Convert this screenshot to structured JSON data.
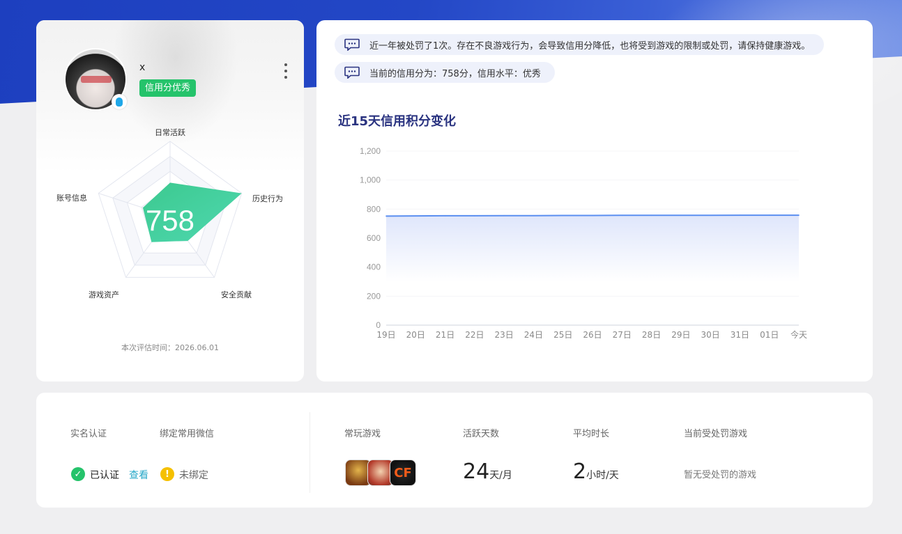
{
  "profile": {
    "username": "x",
    "credit_tag": "信用分优秀",
    "score": "758",
    "eval_time": "本次评估时间：2026.06.01",
    "radar": {
      "axes": [
        "日常活跃",
        "历史行为",
        "安全贡献",
        "游戏资产",
        "账号信息"
      ],
      "values": [
        0.45,
        1.0,
        0.4,
        0.42,
        0.38
      ]
    }
  },
  "notices": [
    "近一年被处罚了1次。存在不良游戏行为，会导致信用分降低，也将受到游戏的限制或处罚，请保持健康游戏。",
    "当前的信用分为：758分，信用水平：优秀"
  ],
  "chart_data": {
    "type": "area",
    "title": "近15天信用积分变化",
    "categories": [
      "19日",
      "20日",
      "21日",
      "22日",
      "23日",
      "24日",
      "25日",
      "26日",
      "27日",
      "28日",
      "29日",
      "30日",
      "31日",
      "01日",
      "今天"
    ],
    "values": [
      752,
      753,
      754,
      754,
      755,
      755,
      756,
      756,
      757,
      757,
      757,
      757,
      758,
      758,
      758
    ],
    "ylim": [
      0,
      1200
    ],
    "yticks": [
      0,
      200,
      400,
      600,
      800,
      1000,
      1200
    ],
    "ytick_labels": [
      "0",
      "200",
      "400",
      "600",
      "800",
      "1,000",
      "1,200"
    ],
    "color": "#5b8ff0"
  },
  "info": {
    "realname_label": "实名认证",
    "wechat_label": "绑定常用微信",
    "realname_value": "已认证",
    "view_link": "查看",
    "wechat_value": "未绑定",
    "games_label": "常玩游戏",
    "games": [
      "王者荣耀",
      "英雄联盟",
      "穿越火线"
    ],
    "active_days_label": "活跃天数",
    "active_days": "24",
    "active_days_unit": "天/月",
    "avg_time_label": "平均时长",
    "avg_time": "2",
    "avg_time_unit": "小时/天",
    "punished_label": "当前受处罚游戏",
    "punished_value": "暂无受处罚的游戏"
  },
  "colors": {
    "accent": "#2a3380",
    "green": "#25c36b",
    "warn": "#f5c000",
    "link": "#27a8c8"
  }
}
